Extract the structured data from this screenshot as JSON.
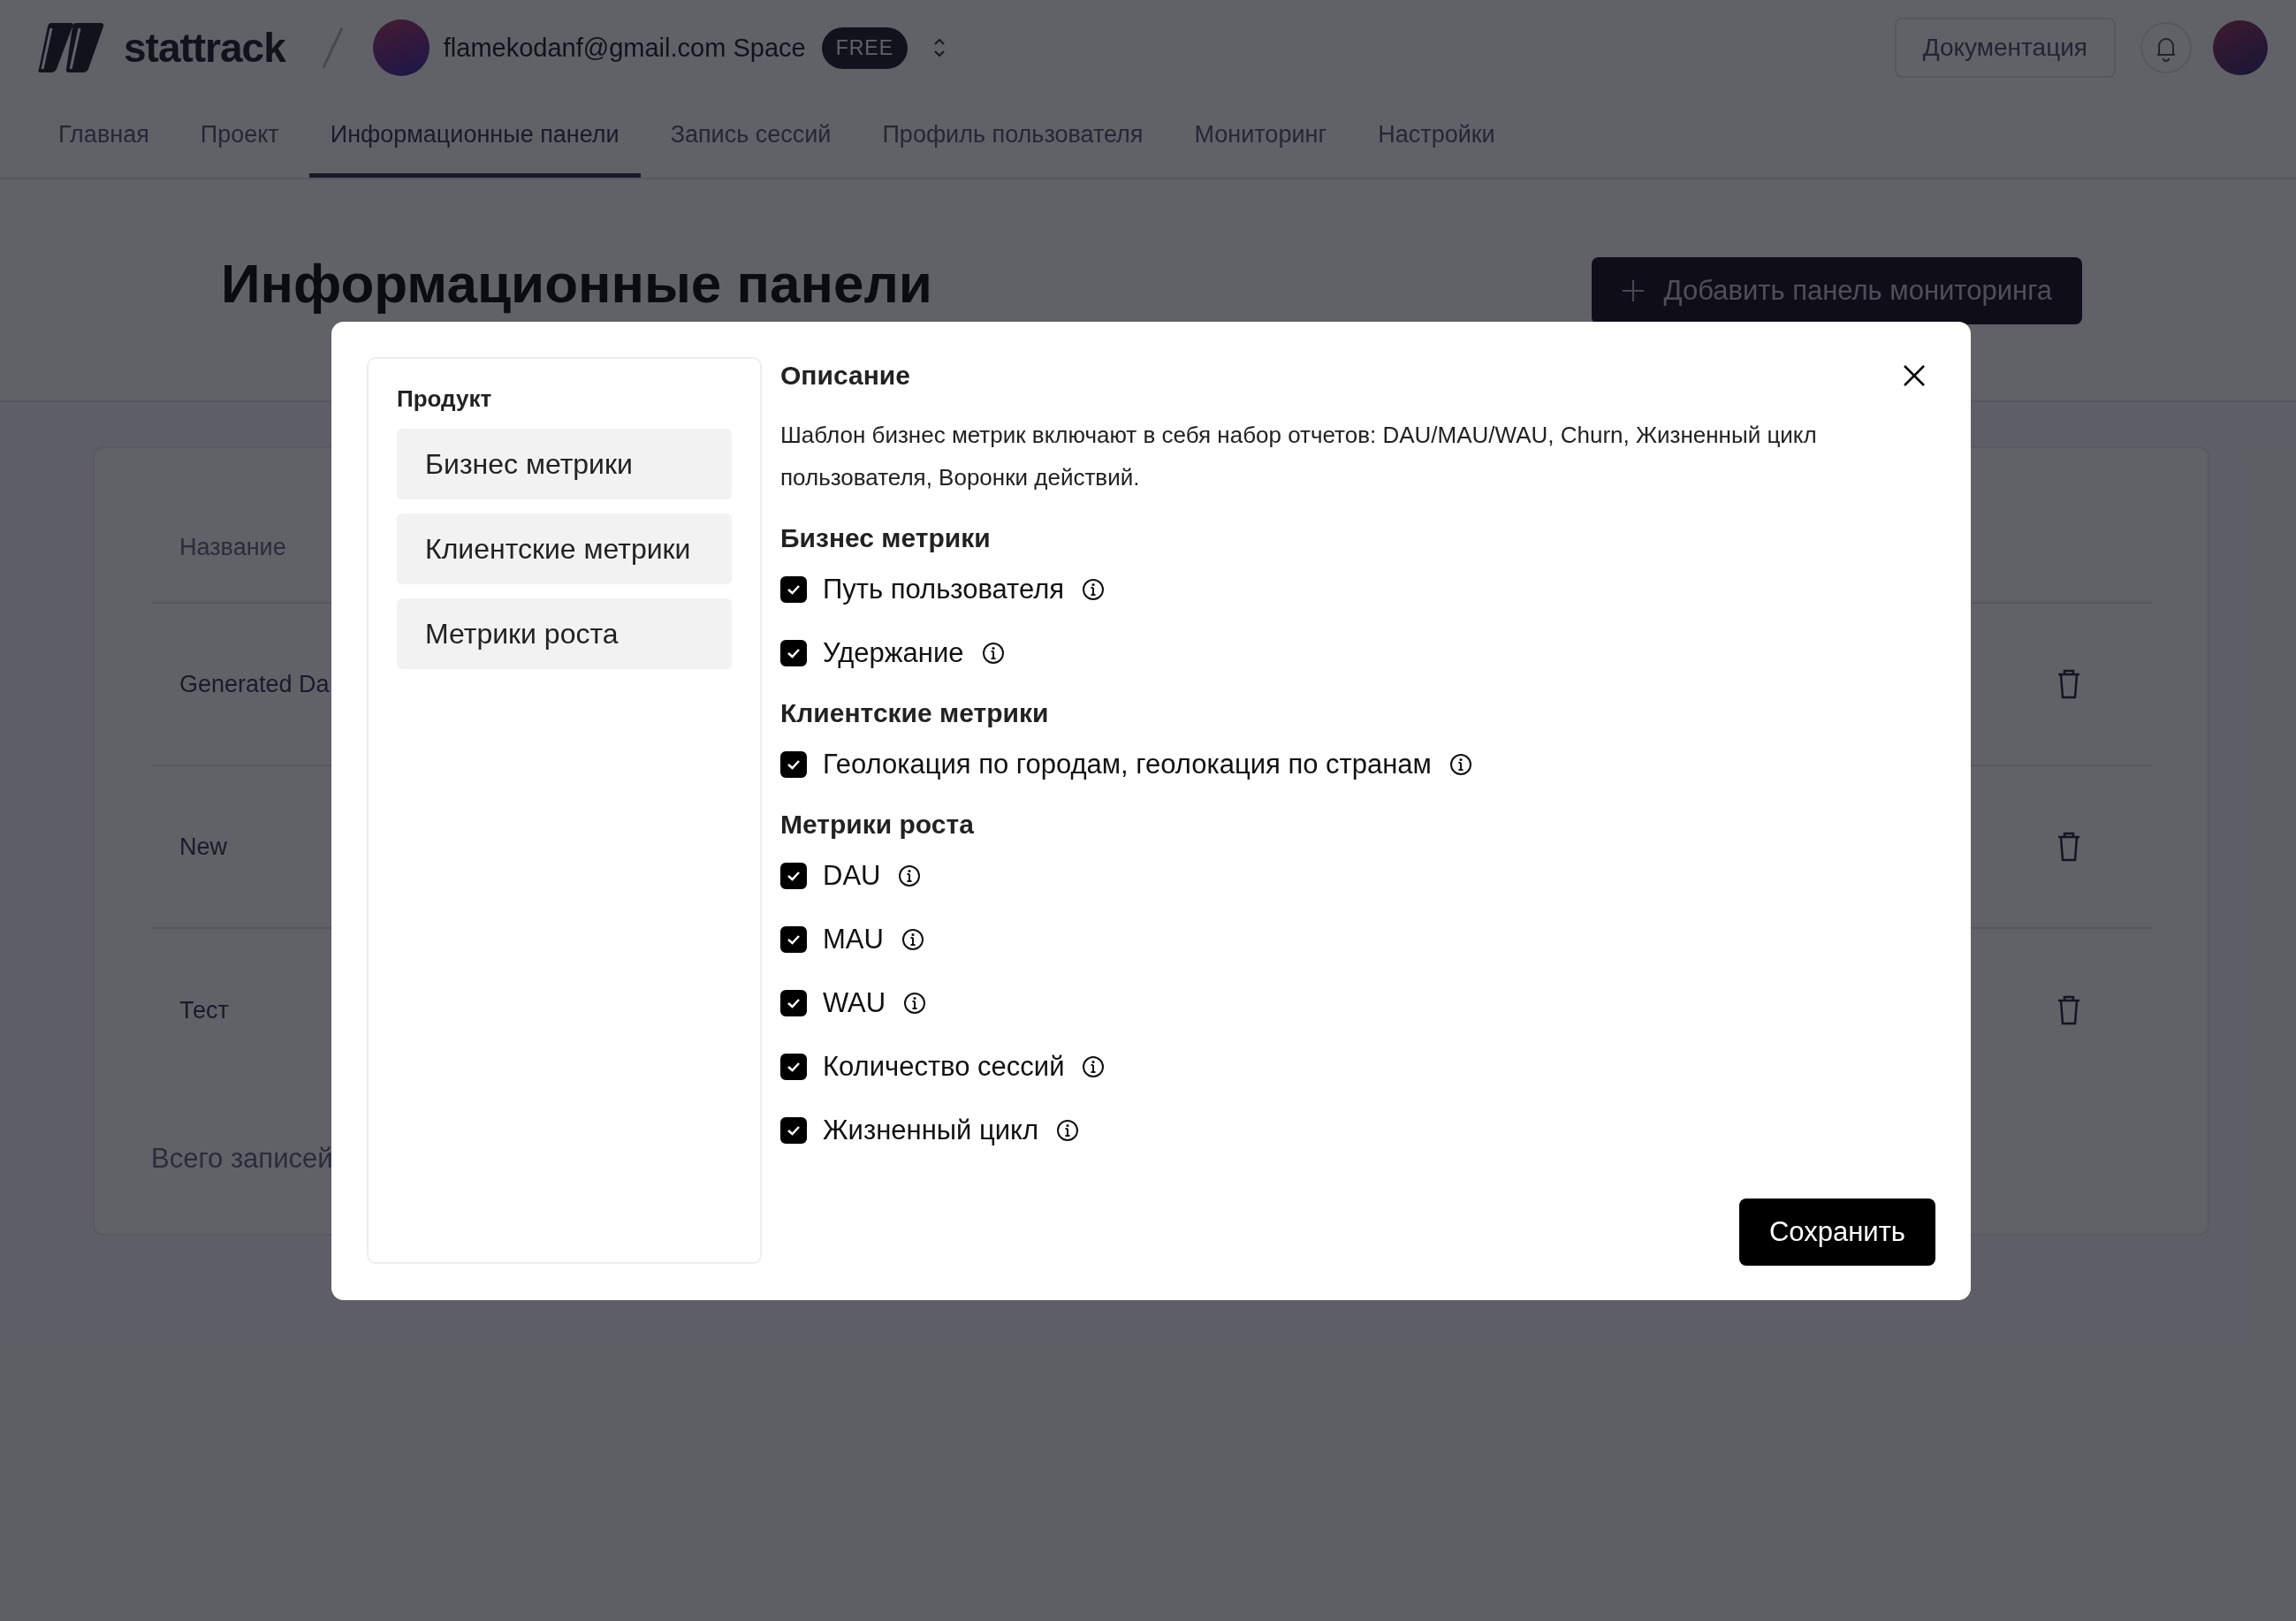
{
  "header": {
    "logo": "stattrack",
    "workspace": "flamekodanf@gmail.com Space",
    "plan_badge": "FREE",
    "docs_button": "Документация"
  },
  "nav_tabs": [
    {
      "label": "Главная",
      "selected": false
    },
    {
      "label": "Проект",
      "selected": false
    },
    {
      "label": "Информационные панели",
      "selected": true
    },
    {
      "label": "Запись сессий",
      "selected": false
    },
    {
      "label": "Профиль пользователя",
      "selected": false
    },
    {
      "label": "Мониторинг",
      "selected": false
    },
    {
      "label": "Настройки",
      "selected": false
    }
  ],
  "page": {
    "title": "Информационные панели",
    "add_button": "Добавить панель мониторинга"
  },
  "table": {
    "columns": [
      "Название"
    ],
    "rows": [
      {
        "name": "Generated Da"
      },
      {
        "name": "New"
      },
      {
        "name": "Тест"
      }
    ],
    "footer": "Всего записей"
  },
  "modal": {
    "sidebar": {
      "title": "Продукт",
      "items": [
        {
          "label": "Бизнес метрики"
        },
        {
          "label": "Клиентские метрики"
        },
        {
          "label": "Метрики роста"
        }
      ]
    },
    "description_title": "Описание",
    "description": "Шаблон бизнес метрик включают в себя набор отчетов: DAU/MAU/WAU, Churn, Жизненный цикл пользователя, Воронки действий.",
    "groups": [
      {
        "title": "Бизнес метрики",
        "items": [
          {
            "label": "Путь пользователя",
            "checked": true
          },
          {
            "label": "Удержание",
            "checked": true
          }
        ]
      },
      {
        "title": "Клиентские метрики",
        "items": [
          {
            "label": "Геолокация по городам, геолокация по странам",
            "checked": true
          }
        ]
      },
      {
        "title": "Метрики роста",
        "items": [
          {
            "label": "DAU",
            "checked": true
          },
          {
            "label": "MAU",
            "checked": true
          },
          {
            "label": "WAU",
            "checked": true
          },
          {
            "label": "Количество сессий",
            "checked": true
          },
          {
            "label": "Жизненный цикл",
            "checked": true
          }
        ]
      }
    ],
    "save_button": "Сохранить"
  }
}
